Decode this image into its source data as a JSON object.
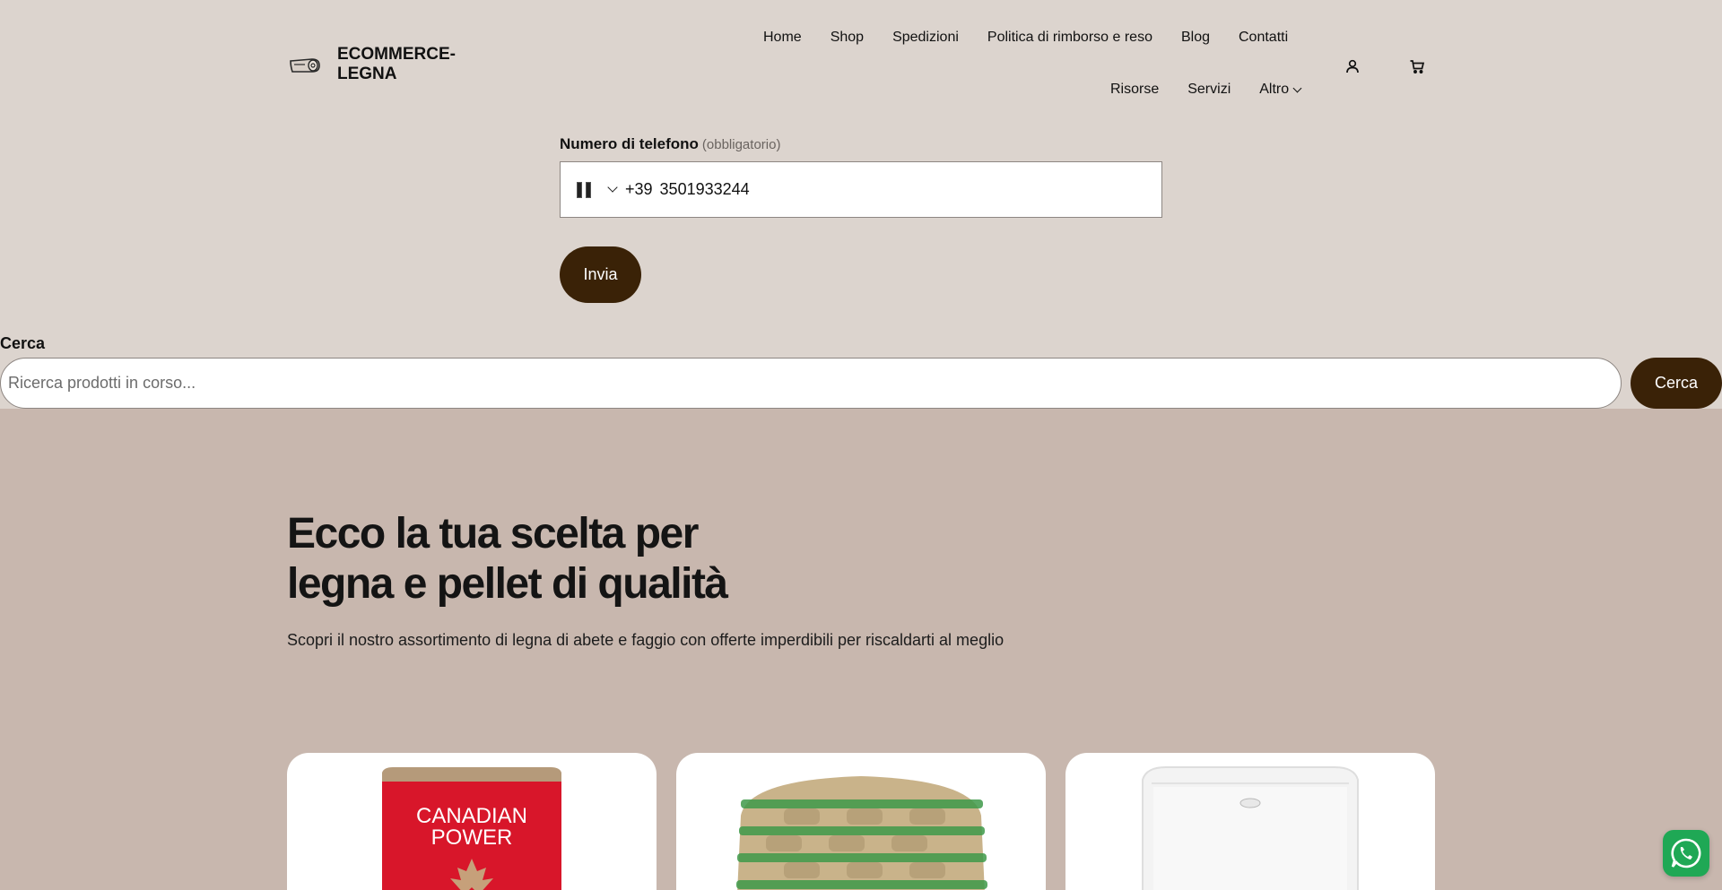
{
  "brand": {
    "name": "ECOMMERCE-LEGNA",
    "logo_icon": "wood-log-icon"
  },
  "nav": {
    "row1": [
      "Home",
      "Shop",
      "Spedizioni",
      "Politica di rimborso e reso",
      "Blog",
      "Contatti"
    ],
    "row2": [
      "Risorse",
      "Servizi"
    ],
    "more_label": "Altro"
  },
  "header_icons": {
    "account": "user-icon",
    "cart": "cart-icon"
  },
  "form": {
    "phone_label": "Numero di telefono",
    "phone_required": "(obbligatorio)",
    "dial_code": "+39",
    "phone_value": "3501933244",
    "submit_label": "Invia"
  },
  "search": {
    "label": "Cerca",
    "placeholder": "Ricerca prodotti in corso...",
    "button_label": "Cerca"
  },
  "hero": {
    "title": "Ecco la tua scelta per legna e pellet di qualità",
    "subtitle": "Scopri il nostro assortimento di legna di abete e faggio con offerte imperdibili per riscaldarti al meglio"
  },
  "products": [
    {
      "image_text_line1": "CANADIAN",
      "image_text_line2": "POWER"
    },
    {
      "image": "pellet-pallet"
    },
    {
      "image": "white-appliance"
    }
  ],
  "colors": {
    "header_bg": "#dcd4ce",
    "hero_bg": "#c8b7ae",
    "accent": "#3a2207",
    "whatsapp": "#1fa855"
  }
}
